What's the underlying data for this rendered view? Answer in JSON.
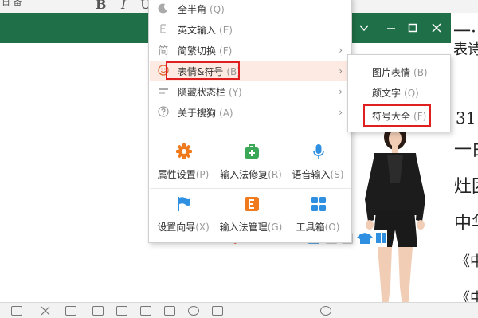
{
  "editor": {
    "corner_label": "日 备",
    "format_buttons": [
      "B",
      "I",
      "U"
    ],
    "side_text": [
      "一·",
      "表诗诣",
      "31",
      "一白",
      "灶团",
      "中华",
      "《中",
      "《中"
    ]
  },
  "menu": {
    "items": [
      {
        "label": "全半角",
        "shortcut": "(Q)",
        "icon": "moon-icon"
      },
      {
        "label": "英文输入",
        "shortcut": "(E)",
        "icon": "english-input-icon"
      },
      {
        "label": "简繁切换",
        "shortcut": "(F)",
        "icon": "simplified-traditional-icon",
        "submenu": true
      },
      {
        "label": "表情&符号",
        "shortcut": "(B)",
        "icon": "smiley-icon",
        "submenu": true,
        "active": true
      },
      {
        "label": "隐藏状态栏",
        "shortcut": "(Y)",
        "icon": "hide-statusbar-icon",
        "submenu": true
      },
      {
        "label": "关于搜狗",
        "shortcut": "(A)",
        "icon": "help-icon",
        "submenu": true
      }
    ],
    "simplified_icon_glyph": "简",
    "arrow": "›",
    "grid": [
      {
        "label": "属性设置",
        "shortcut": "(P)",
        "icon": "gear-icon",
        "color": "#f07a1e"
      },
      {
        "label": "输入法修复",
        "shortcut": "(R)",
        "icon": "repair-kit-icon",
        "color": "#3aa856"
      },
      {
        "label": "语音输入",
        "shortcut": "(S)",
        "icon": "microphone-icon",
        "color": "#2f8fe0"
      },
      {
        "label": "设置向导",
        "shortcut": "(X)",
        "icon": "flag-icon",
        "color": "#2f8fe0"
      },
      {
        "label": "输入法管理",
        "shortcut": "(G)",
        "icon": "ime-manager-icon",
        "color": "#f07a1e"
      },
      {
        "label": "工具箱",
        "shortcut": "(O)",
        "icon": "toolbox-grid-icon",
        "color": "#2f8fe0"
      }
    ]
  },
  "submenu": {
    "items": [
      {
        "label": "图片表情",
        "shortcut": "(B)"
      },
      {
        "label": "颜文字",
        "shortcut": "(Q)"
      },
      {
        "label": "符号大全",
        "shortcut": "(F)"
      }
    ]
  },
  "colors": {
    "titlebar": "#1f7048",
    "active_item_bg": "#fdeae2",
    "highlight_border": "#e02020"
  }
}
